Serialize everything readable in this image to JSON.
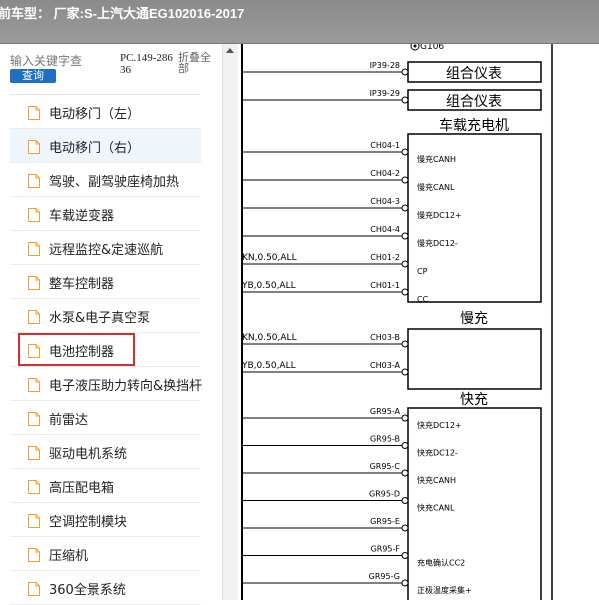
{
  "window": {
    "title": "前车型：  厂家:S-上汽大通EG102016-2017"
  },
  "sidebar": {
    "search_placeholder": "输入关键字查",
    "query_label": "查询",
    "pc_code": "PC.149-28636",
    "fold_all_label": "折叠全部",
    "selected_index": 1,
    "highlighted_index": 7,
    "items": [
      {
        "label": "电动移门（左）"
      },
      {
        "label": "电动移门（右）"
      },
      {
        "label": "驾驶、副驾驶座椅加热"
      },
      {
        "label": "车载逆变器"
      },
      {
        "label": "远程监控&定速巡航"
      },
      {
        "label": "整车控制器"
      },
      {
        "label": "水泵&电子真空泵"
      },
      {
        "label": "电池控制器"
      },
      {
        "label": "电子液压助力转向&换挡杆"
      },
      {
        "label": "前雷达"
      },
      {
        "label": "驱动电机系统"
      },
      {
        "label": "高压配电箱"
      },
      {
        "label": "空调控制模块"
      },
      {
        "label": "压缩机"
      },
      {
        "label": "360全景系统"
      }
    ]
  },
  "diagram": {
    "g_label": "G106",
    "combo_cluster_label": "组合仪表",
    "ip_pins": [
      "IP39-28",
      "IP39-29"
    ],
    "charger_title": "车载充电机",
    "charger_pins": [
      {
        "pin": "CH04-1",
        "signal": "慢充CANH",
        "wire": ""
      },
      {
        "pin": "CH04-2",
        "signal": "慢充CANL",
        "wire": ""
      },
      {
        "pin": "CH04-3",
        "signal": "慢充DC12+",
        "wire": ""
      },
      {
        "pin": "CH04-4",
        "signal": "慢充DC12-",
        "wire": ""
      },
      {
        "pin": "CH01-2",
        "signal": "CP",
        "wire": "KN,0.50,ALL"
      },
      {
        "pin": "CH01-1",
        "signal": "CC",
        "wire": "YB,0.50,ALL"
      }
    ],
    "slow_title": "慢充",
    "slow_pins": [
      {
        "pin": "CH03-B",
        "wire": "KN,0.50,ALL"
      },
      {
        "pin": "CH03-A",
        "wire": "YB,0.50,ALL"
      }
    ],
    "fast_title": "快充",
    "fast_pins": [
      {
        "pin": "GR95-A",
        "signal": "快充DC12+"
      },
      {
        "pin": "GR95-B",
        "signal": "快充DC12-"
      },
      {
        "pin": "GR95-C",
        "signal": "快充CANH"
      },
      {
        "pin": "GR95-D",
        "signal": "快充CANL"
      },
      {
        "pin": "GR95-E",
        "signal": ""
      },
      {
        "pin": "GR95-F",
        "signal": "充电确认CC2"
      },
      {
        "pin": "GR95-G",
        "signal": "正极温度采集+"
      }
    ]
  }
}
